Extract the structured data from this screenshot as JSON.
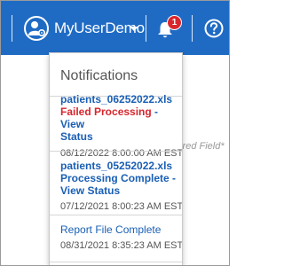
{
  "header": {
    "username": "MyUserDemo",
    "notification_count": "1"
  },
  "background": {
    "required_field_text": "uired Field*"
  },
  "notifications": {
    "title": "Notifications",
    "items": [
      {
        "file": "patients_06252022.xls",
        "status": "Failed Processing",
        "separator": " - ",
        "link_part1": "View",
        "link_part2": "Status",
        "date": "08/12/2022 8:00:00 AM EST"
      },
      {
        "file": "patients_05252022.xls",
        "status_line1": "Processing Complete -",
        "status_line2": "View Status",
        "date": "07/12/2021 8:00:23 AM EST"
      },
      {
        "title": "Report File Complete",
        "date": "08/31/2021 8:35:23 AM EST"
      }
    ]
  }
}
